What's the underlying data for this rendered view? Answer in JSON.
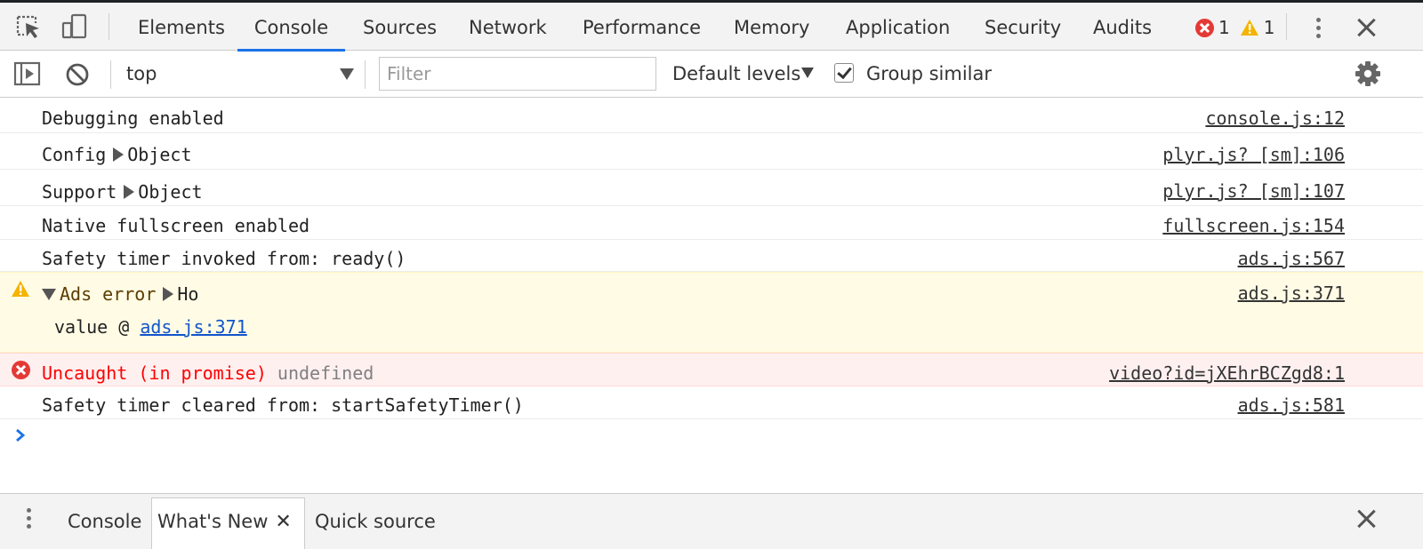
{
  "tabs": [
    {
      "label": "Elements"
    },
    {
      "label": "Console"
    },
    {
      "label": "Sources"
    },
    {
      "label": "Network"
    },
    {
      "label": "Performance"
    },
    {
      "label": "Memory"
    },
    {
      "label": "Application"
    },
    {
      "label": "Security"
    },
    {
      "label": "Audits"
    }
  ],
  "active_tab": "Console",
  "counters": {
    "errors": "1",
    "warnings": "1"
  },
  "icons": {
    "inspect": "inspect-element-icon",
    "device": "device-toolbar-icon",
    "sidebar": "show-sidebar-icon",
    "clear": "clear-console-icon",
    "settings": "gear-icon",
    "more": "kebab-menu-icon",
    "close": "close-icon"
  },
  "toolbar": {
    "context": "top",
    "filter_placeholder": "Filter",
    "levels": "Default levels",
    "group_similar": "Group similar",
    "group_similar_checked": true
  },
  "messages": [
    {
      "text": "Debugging enabled",
      "source": "console.js:12"
    },
    {
      "label": "Config",
      "object": "Object",
      "source": "plyr.js? [sm]:106"
    },
    {
      "label": "Support",
      "object": "Object",
      "source": "plyr.js? [sm]:107"
    },
    {
      "text": "Native fullscreen enabled",
      "source": "fullscreen.js:154"
    },
    {
      "text": "Safety timer invoked from: ready()",
      "source": "ads.js:567"
    },
    {
      "label": "Ads error",
      "object": "Ho",
      "stack_fn": "value @",
      "stack_link": "ads.js:371",
      "source": "ads.js:371"
    },
    {
      "text": "Uncaught (in promise)",
      "extra": "undefined",
      "source": "video?id=jXEhrBCZgd8:1"
    },
    {
      "text": "Safety timer cleared from: startSafetyTimer()",
      "source": "ads.js:581"
    }
  ],
  "drawer": {
    "tabs": [
      {
        "label": "Console"
      },
      {
        "label": "What's New"
      },
      {
        "label": "Quick source"
      }
    ],
    "active": "What's New",
    "close_glyph": "✕"
  },
  "colors": {
    "accent": "#1a73e8",
    "error": "#e53935",
    "warning": "#f4b400",
    "warn_bg": "#fffbe5",
    "error_bg": "#fff0f0"
  }
}
